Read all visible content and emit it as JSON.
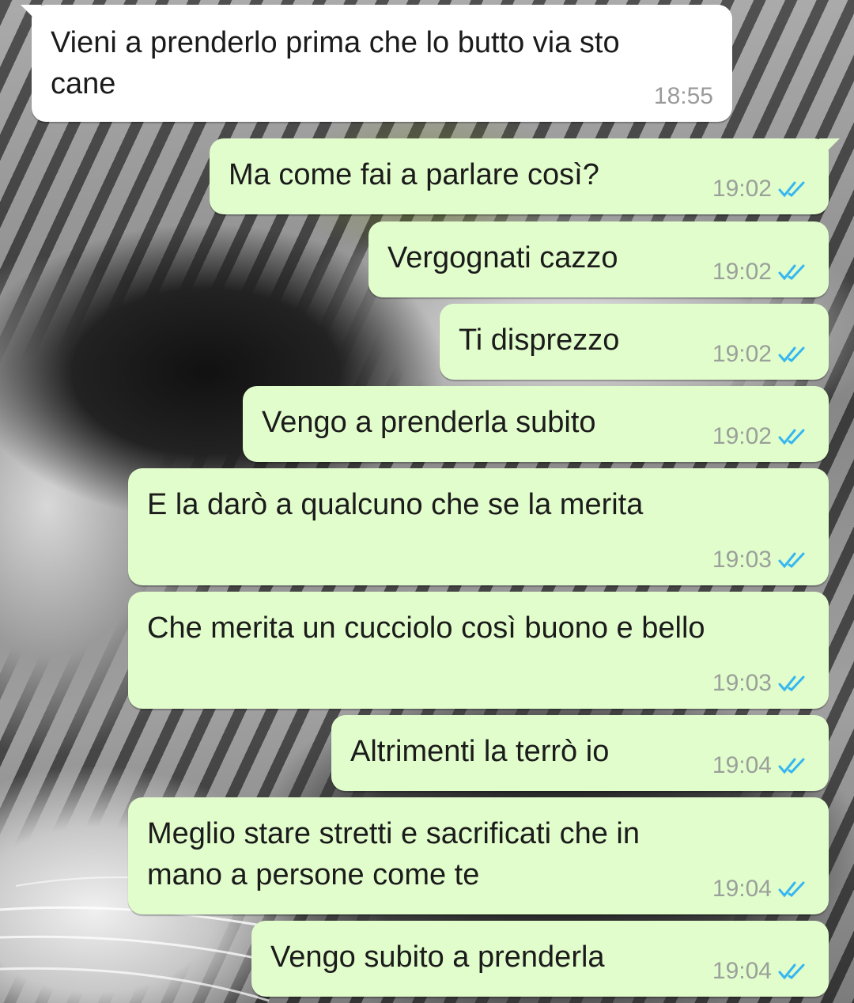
{
  "chat": {
    "messages": [
      {
        "direction": "in",
        "text": "Vieni a prenderlo prima che lo butto via sto\ncane",
        "time": "18:55"
      },
      {
        "direction": "out",
        "text": "Ma come fai a parlare così?",
        "time": "19:02",
        "status_icon": "double-check-read-icon"
      },
      {
        "direction": "out",
        "text": "Vergognati cazzo",
        "time": "19:02",
        "status_icon": "double-check-read-icon"
      },
      {
        "direction": "out",
        "text": "Ti disprezzo",
        "time": "19:02",
        "status_icon": "double-check-read-icon"
      },
      {
        "direction": "out",
        "text": "Vengo a prenderla subito",
        "time": "19:02",
        "status_icon": "double-check-read-icon"
      },
      {
        "direction": "out",
        "text": "E la darò a qualcuno che se la merita",
        "time": "19:03",
        "status_icon": "double-check-read-icon"
      },
      {
        "direction": "out",
        "text": "Che merita un cucciolo così buono e bello",
        "time": "19:03",
        "status_icon": "double-check-read-icon"
      },
      {
        "direction": "out",
        "text": "Altrimenti la terrò io",
        "time": "19:04",
        "status_icon": "double-check-read-icon"
      },
      {
        "direction": "out",
        "text": "Meglio stare stretti e sacrificati che in\nmano a persone come te",
        "time": "19:04",
        "status_icon": "double-check-read-icon"
      },
      {
        "direction": "out",
        "text": "Vengo subito a prenderla",
        "time": "19:04",
        "status_icon": "double-check-read-icon"
      }
    ]
  },
  "colors": {
    "incoming_bubble": "#ffffff",
    "outgoing_bubble": "#e2fdcc",
    "read_ticks": "#34b7f1",
    "timestamp": "#9aa09a"
  }
}
